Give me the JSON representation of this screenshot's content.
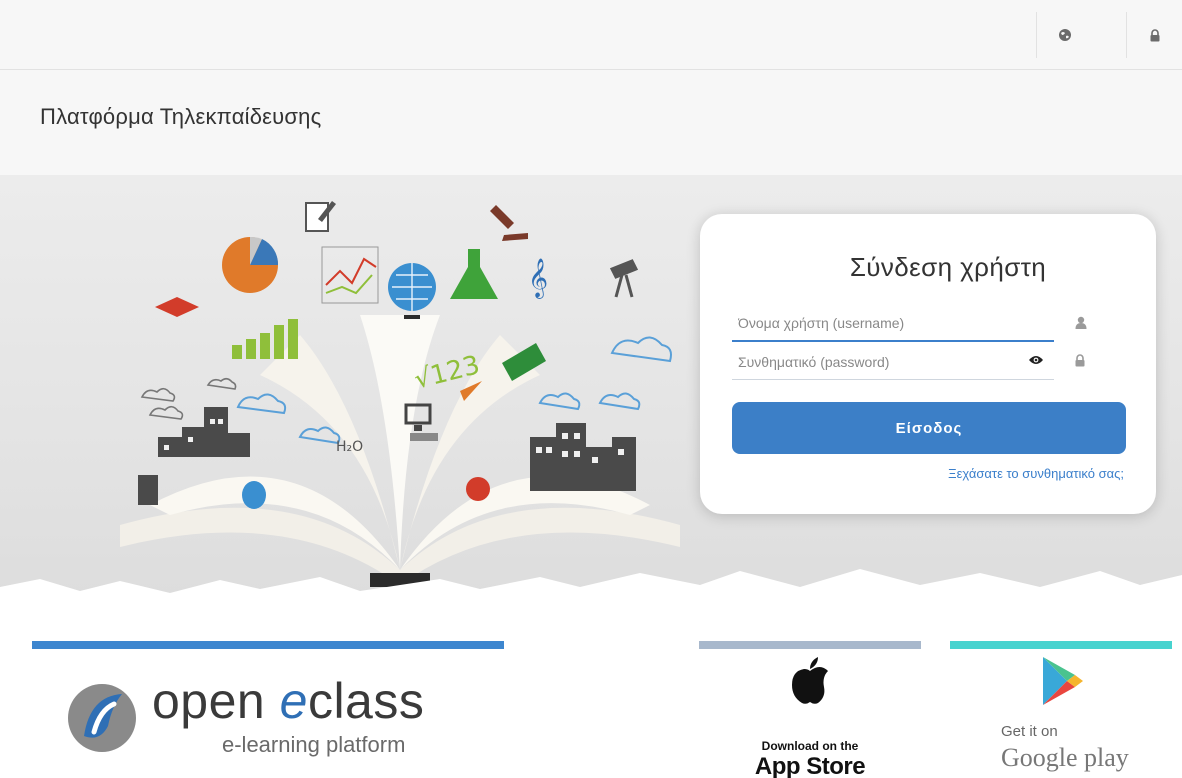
{
  "topbar": {
    "language_icon": "globe-icon",
    "login_icon": "lock-icon"
  },
  "site": {
    "title": "Πλατφόρμα Τηλεκπαίδευσης"
  },
  "login": {
    "title": "Σύνδεση χρήστη",
    "username_placeholder": "Όνομα χρήστη (username)",
    "password_placeholder": "Συνθηματικό (password)",
    "submit_label": "Είσοδος",
    "forgot_label": "Ξεχάσατε το συνθηματικό σας;",
    "accent_color": "#3c7fc7"
  },
  "footer": {
    "brand_open": "open ",
    "brand_e": "e",
    "brand_class": "class",
    "brand_sub": "e-learning platform",
    "appstore_line1": "Download on the",
    "appstore_line2": "App Store",
    "googleplay_line1": "Get it on",
    "googleplay_line2": "Google play",
    "bar_colors": [
      "#3d86cf",
      "#a8b8cc",
      "#47d3cf"
    ]
  }
}
